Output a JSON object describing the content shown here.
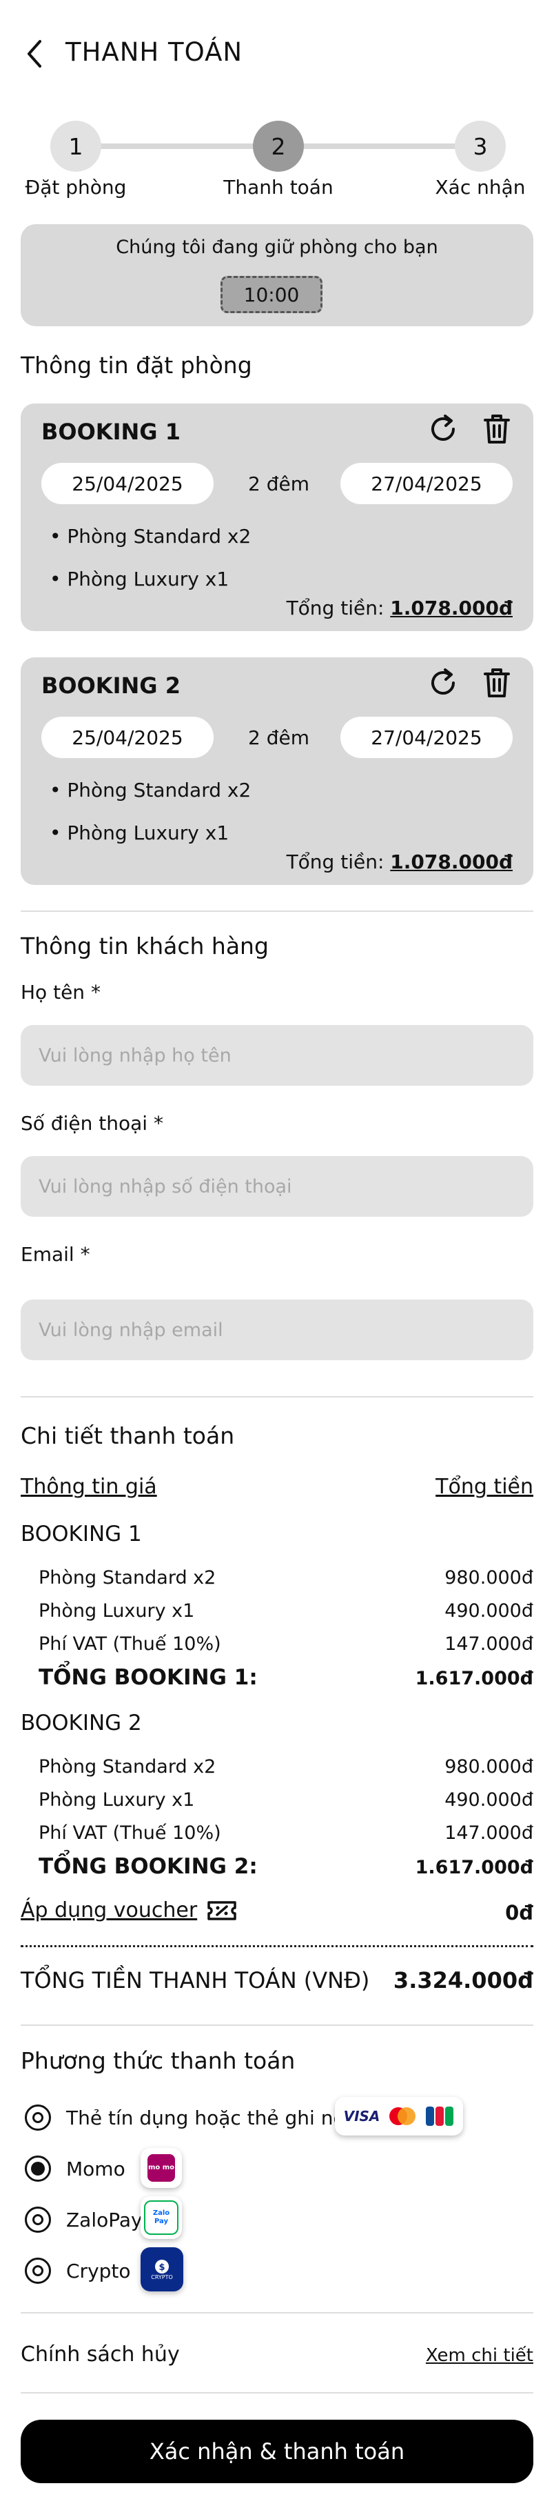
{
  "header": {
    "title": "THANH TOÁN"
  },
  "steps": [
    {
      "number": "1",
      "label": "Đặt phòng"
    },
    {
      "number": "2",
      "label": "Thanh toán"
    },
    {
      "number": "3",
      "label": "Xác nhận"
    }
  ],
  "hold": {
    "message": "Chúng tôi đang giữ phòng cho bạn",
    "timer": "10:00"
  },
  "booking_section": {
    "title": "Thông tin đặt phòng"
  },
  "bookings": [
    {
      "title": "BOOKING 1",
      "checkin": "25/04/2025",
      "nights": "2 đêm",
      "checkout": "27/04/2025",
      "rooms": [
        "Phòng Standard x2",
        "Phòng Luxury x1"
      ],
      "total_label": "Tổng tiền:",
      "total_value": "1.078.000đ"
    },
    {
      "title": "BOOKING 2",
      "checkin": "25/04/2025",
      "nights": "2 đêm",
      "checkout": "27/04/2025",
      "rooms": [
        "Phòng Standard x2",
        "Phòng Luxury x1"
      ],
      "total_label": "Tổng tiền:",
      "total_value": "1.078.000đ"
    }
  ],
  "customer": {
    "title": "Thông tin khách hàng",
    "name_label": "Họ tên",
    "name_placeholder": "Vui lòng nhập họ tên",
    "phone_label": "Số điện thoại",
    "phone_placeholder": "Vui lòng nhập số điện thoại",
    "email_label": "Email",
    "email_placeholder": "Vui lòng nhập email",
    "required_mark": "*"
  },
  "payment_detail": {
    "title": "Chi tiết thanh toán",
    "col_left": "Thông tin giá",
    "col_right": "Tổng tiền",
    "bookings": [
      {
        "title": "BOOKING 1",
        "rows": [
          {
            "label": "Phòng Standard x2",
            "value": "980.000đ"
          },
          {
            "label": "Phòng Luxury x1",
            "value": "490.000đ"
          },
          {
            "label": "Phí VAT (Thuế 10%)",
            "value": "147.000đ"
          }
        ],
        "total_label": "TỔNG BOOKING 1:",
        "total_value": "1.617.000đ"
      },
      {
        "title": "BOOKING 2",
        "rows": [
          {
            "label": "Phòng Standard x2",
            "value": "980.000đ"
          },
          {
            "label": "Phòng Luxury x1",
            "value": "490.000đ"
          },
          {
            "label": "Phí VAT (Thuế 10%)",
            "value": "147.000đ"
          }
        ],
        "total_label": "TỔNG BOOKING 2:",
        "total_value": "1.617.000đ"
      }
    ],
    "voucher_label": "Áp dụng voucher",
    "voucher_value": "0đ",
    "grand_label": "TỔNG TIỀN THANH TOÁN (VNĐ)",
    "grand_value": "3.324.000đ"
  },
  "payment_methods": {
    "title": "Phương thức thanh toán",
    "items": [
      {
        "label": "Thẻ tín dụng hoặc thẻ ghi nợ",
        "selected": false,
        "logo": "card-logos"
      },
      {
        "label": "Momo",
        "selected": true,
        "logo": "momo-logo"
      },
      {
        "label": "ZaloPay",
        "selected": false,
        "logo": "zalopay-logo"
      },
      {
        "label": "Crypto",
        "selected": false,
        "logo": "crypto-logo"
      }
    ],
    "logo_text": {
      "visa": "VISA",
      "momo": "mo mo",
      "zalo": "Zalo Pay",
      "crypto": "CRYPTO"
    }
  },
  "policy": {
    "title": "Chính sách hủy",
    "link": "Xem chi tiết"
  },
  "cta": {
    "label": "Xác nhận & thanh toán"
  },
  "colors": {
    "card_bg": "#d9d9d9",
    "cta_bg": "#000000",
    "momo": "#a50064",
    "zalo": "#0068ff",
    "crypto": "#0a2a8a"
  }
}
